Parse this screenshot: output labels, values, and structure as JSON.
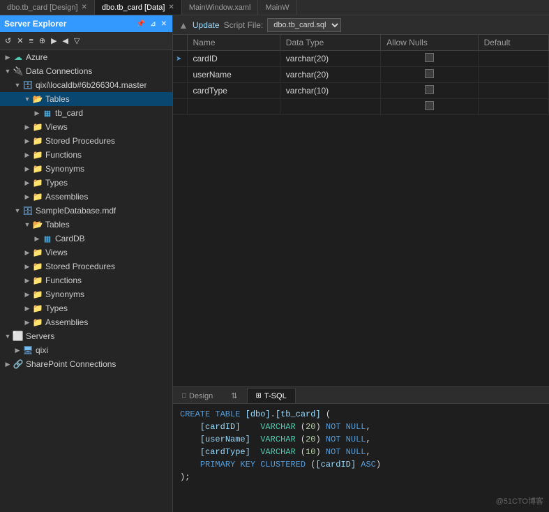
{
  "tabs": [
    {
      "id": "design-tab",
      "label": "dbo.tb_card [Design]",
      "active": false,
      "closable": true
    },
    {
      "id": "data-tab",
      "label": "dbo.tb_card [Data]",
      "active": true,
      "closable": true
    },
    {
      "id": "mainwindow-tab",
      "label": "MainWindow.xaml",
      "active": false,
      "closable": false
    },
    {
      "id": "mainw-tab",
      "label": "MainW",
      "active": false,
      "closable": false
    }
  ],
  "toolbar": {
    "update_label": "Update",
    "script_label": "Script File:",
    "script_file": "dbo.tb_card.sql"
  },
  "table": {
    "columns": [
      "Name",
      "Data Type",
      "Allow Nulls",
      "Default"
    ],
    "rows": [
      {
        "marker": "➤",
        "name": "cardID",
        "dataType": "varchar(20)",
        "allowNulls": false,
        "default": ""
      },
      {
        "marker": "",
        "name": "userName",
        "dataType": "varchar(20)",
        "allowNulls": false,
        "default": ""
      },
      {
        "marker": "",
        "name": "cardType",
        "dataType": "varchar(10)",
        "allowNulls": false,
        "default": ""
      },
      {
        "marker": "",
        "name": "",
        "dataType": "",
        "allowNulls": true,
        "default": ""
      }
    ]
  },
  "sidebar": {
    "title": "Server Explorer",
    "toolbar_buttons": [
      "↺",
      "✕",
      "≡≡",
      "⊕",
      "▶",
      "◀"
    ],
    "tree": [
      {
        "id": "azure",
        "label": "Azure",
        "icon": "cloud",
        "indent": 0,
        "expanded": false
      },
      {
        "id": "data-connections",
        "label": "Data Connections",
        "icon": "conn",
        "indent": 0,
        "expanded": true
      },
      {
        "id": "qixi-db",
        "label": "qixi\\localdb#6b266304.master",
        "icon": "db",
        "indent": 1,
        "expanded": true
      },
      {
        "id": "tables",
        "label": "Tables",
        "icon": "folder-open",
        "indent": 2,
        "expanded": true,
        "selected": true
      },
      {
        "id": "tb-card",
        "label": "tb_card",
        "icon": "table",
        "indent": 3,
        "expanded": false
      },
      {
        "id": "views1",
        "label": "Views",
        "icon": "folder",
        "indent": 2,
        "expanded": false
      },
      {
        "id": "stored-procs1",
        "label": "Stored Procedures",
        "icon": "folder",
        "indent": 2,
        "expanded": false
      },
      {
        "id": "functions1",
        "label": "Functions",
        "icon": "folder",
        "indent": 2,
        "expanded": false
      },
      {
        "id": "synonyms1",
        "label": "Synonyms",
        "icon": "folder",
        "indent": 2,
        "expanded": false
      },
      {
        "id": "types1",
        "label": "Types",
        "icon": "folder",
        "indent": 2,
        "expanded": false
      },
      {
        "id": "assemblies1",
        "label": "Assemblies",
        "icon": "folder",
        "indent": 2,
        "expanded": false
      },
      {
        "id": "sample-db",
        "label": "SampleDatabase.mdf",
        "icon": "db",
        "indent": 1,
        "expanded": true
      },
      {
        "id": "tables2",
        "label": "Tables",
        "icon": "folder-open",
        "indent": 2,
        "expanded": true
      },
      {
        "id": "carddb",
        "label": "CardDB",
        "icon": "table",
        "indent": 3,
        "expanded": false
      },
      {
        "id": "views2",
        "label": "Views",
        "icon": "folder",
        "indent": 2,
        "expanded": false
      },
      {
        "id": "stored-procs2",
        "label": "Stored Procedures",
        "icon": "folder",
        "indent": 2,
        "expanded": false
      },
      {
        "id": "functions2",
        "label": "Functions",
        "icon": "folder",
        "indent": 2,
        "expanded": false
      },
      {
        "id": "synonyms2",
        "label": "Synonyms",
        "icon": "folder",
        "indent": 2,
        "expanded": false
      },
      {
        "id": "types2",
        "label": "Types",
        "icon": "folder",
        "indent": 2,
        "expanded": false
      },
      {
        "id": "assemblies2",
        "label": "Assemblies",
        "icon": "folder",
        "indent": 2,
        "expanded": false
      },
      {
        "id": "servers",
        "label": "Servers",
        "icon": "server",
        "indent": 0,
        "expanded": true
      },
      {
        "id": "qixi-server",
        "label": "qixi",
        "icon": "server-item",
        "indent": 1,
        "expanded": false
      },
      {
        "id": "sharepoint",
        "label": "SharePoint Connections",
        "icon": "conn",
        "indent": 0,
        "expanded": false
      }
    ]
  },
  "bottom_tabs": [
    {
      "id": "design",
      "label": "Design",
      "icon": "□",
      "active": false
    },
    {
      "id": "arrows",
      "label": "↕",
      "icon": "",
      "active": false
    },
    {
      "id": "tsql",
      "label": "T-SQL",
      "icon": "⊞",
      "active": true
    }
  ],
  "sql_code": [
    "CREATE TABLE [dbo].[tb_card] (",
    "    [cardID]    VARCHAR (20)  NOT NULL,",
    "    [userName]  VARCHAR (20)  NOT NULL,",
    "    [cardType]  VARCHAR (10)  NOT NULL,",
    "    PRIMARY KEY CLUSTERED ([cardID] ASC)",
    ");"
  ],
  "watermark": "@51CTO博客"
}
